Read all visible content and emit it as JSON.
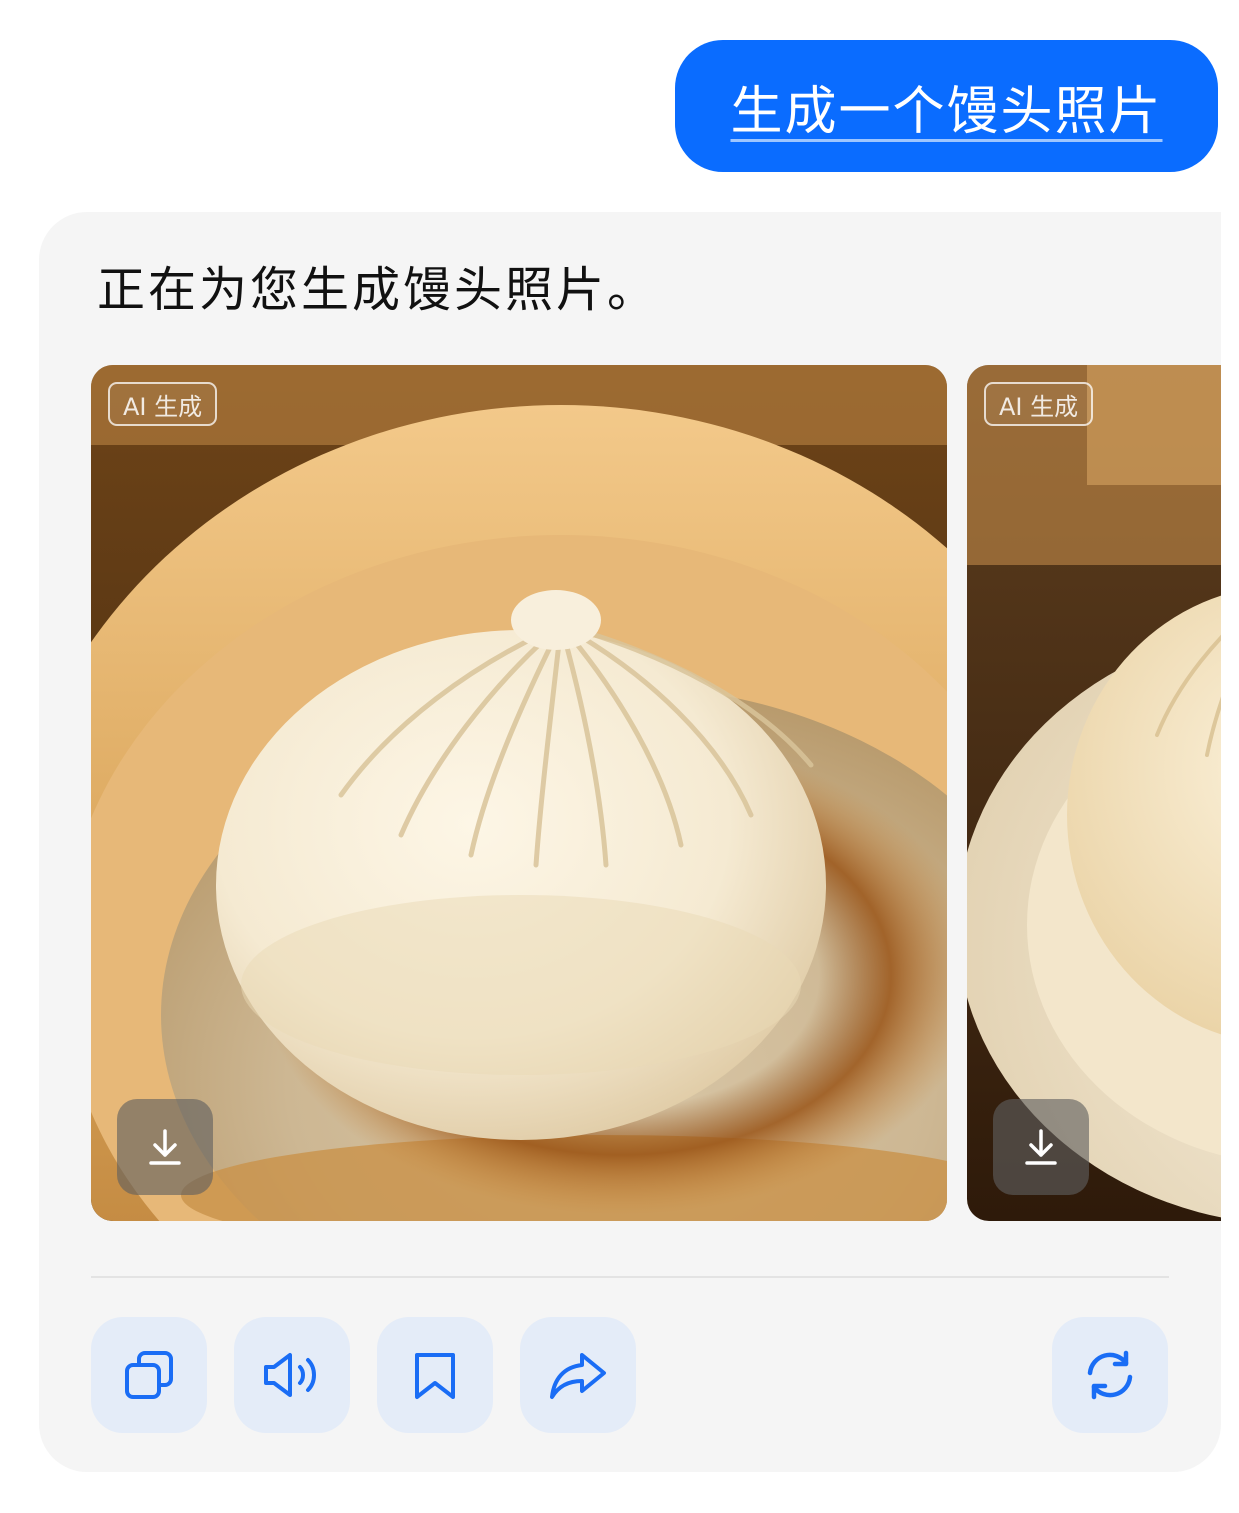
{
  "user_message": {
    "text": "生成一个馒头照片"
  },
  "assistant": {
    "text": "正在为您生成馒头照片。",
    "images": [
      {
        "badge": "AI 生成",
        "download_icon": "download-icon"
      },
      {
        "badge": "AI 生成",
        "download_icon": "download-icon"
      }
    ],
    "actions": [
      {
        "icon": "copy-icon"
      },
      {
        "icon": "speaker-icon"
      },
      {
        "icon": "bookmark-icon"
      },
      {
        "icon": "share-icon"
      },
      {
        "icon": "regenerate-icon"
      }
    ]
  },
  "colors": {
    "accent": "#0a6cff",
    "action_bg": "#e4ecf8",
    "card_bg": "#f5f5f5"
  }
}
